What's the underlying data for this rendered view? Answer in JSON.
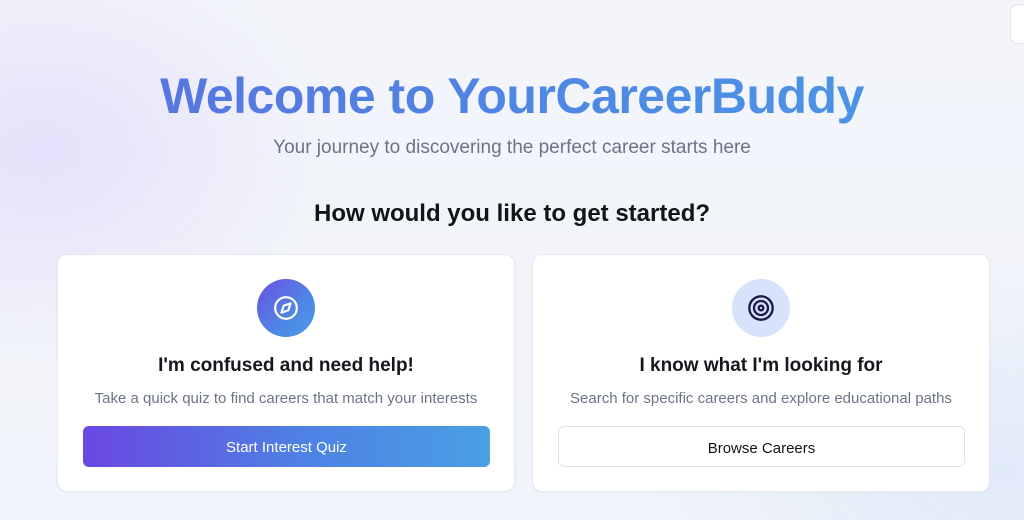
{
  "hero": {
    "title": "Welcome to YourCareerBuddy",
    "subtitle": "Your journey to discovering the perfect career starts here"
  },
  "prompt": {
    "heading": "How would you like to get started?"
  },
  "options": [
    {
      "icon": "compass-icon",
      "title": "I'm confused and need help!",
      "description": "Take a quick quiz to find careers that match your interests",
      "button_label": "Start Interest Quiz"
    },
    {
      "icon": "target-icon",
      "title": "I know what I'm looking for",
      "description": "Search for specific careers and explore educational paths",
      "button_label": "Browse Careers"
    }
  ],
  "colors": {
    "accent_purple": "#6a47e2",
    "accent_blue": "#4a9fe5",
    "title_blue": "#4f86e4",
    "target_icon_bg": "#d6e3fb",
    "target_icon_stroke": "#1d1b4b"
  }
}
